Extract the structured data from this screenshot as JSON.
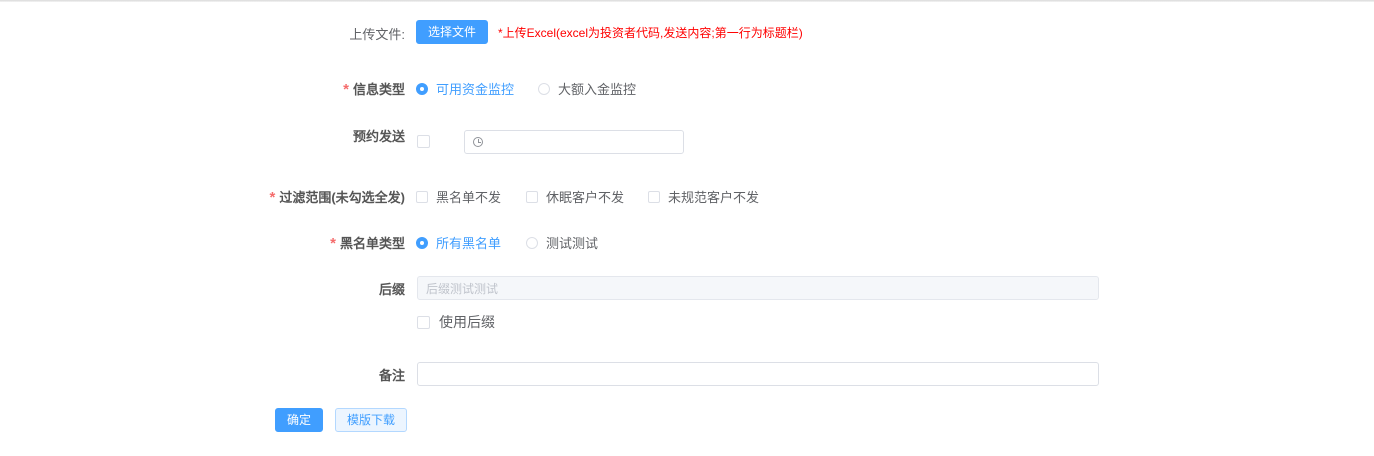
{
  "upload": {
    "label": "上传文件:",
    "button": "选择文件",
    "tip": "*上传Excel(excel为投资者代码,发送内容;第一行为标题栏)"
  },
  "info_type": {
    "required": "*",
    "label": "信息类型",
    "options": [
      "可用资金监控",
      "大额入金监控"
    ],
    "selected": "可用资金监控"
  },
  "schedule": {
    "label": "预约发送",
    "checked": false,
    "time_value": ""
  },
  "filter": {
    "required": "*",
    "label": "过滤范围(未勾选全发)",
    "options": [
      "黑名单不发",
      "休眠客户不发",
      "未规范客户不发"
    ]
  },
  "blacklist_type": {
    "required": "*",
    "label": "黑名单类型",
    "options": [
      "所有黑名单",
      "测试测试"
    ],
    "selected": "所有黑名单"
  },
  "suffix": {
    "label": "后缀",
    "value": "后缀测试测试",
    "use_label": "使用后缀",
    "use_checked": false
  },
  "remark": {
    "label": "备注",
    "value": ""
  },
  "actions": {
    "confirm": "确定",
    "download": "模版下载"
  },
  "colors": {
    "primary": "#409eff",
    "danger": "#f56c6c",
    "tip": "#ff0000"
  }
}
